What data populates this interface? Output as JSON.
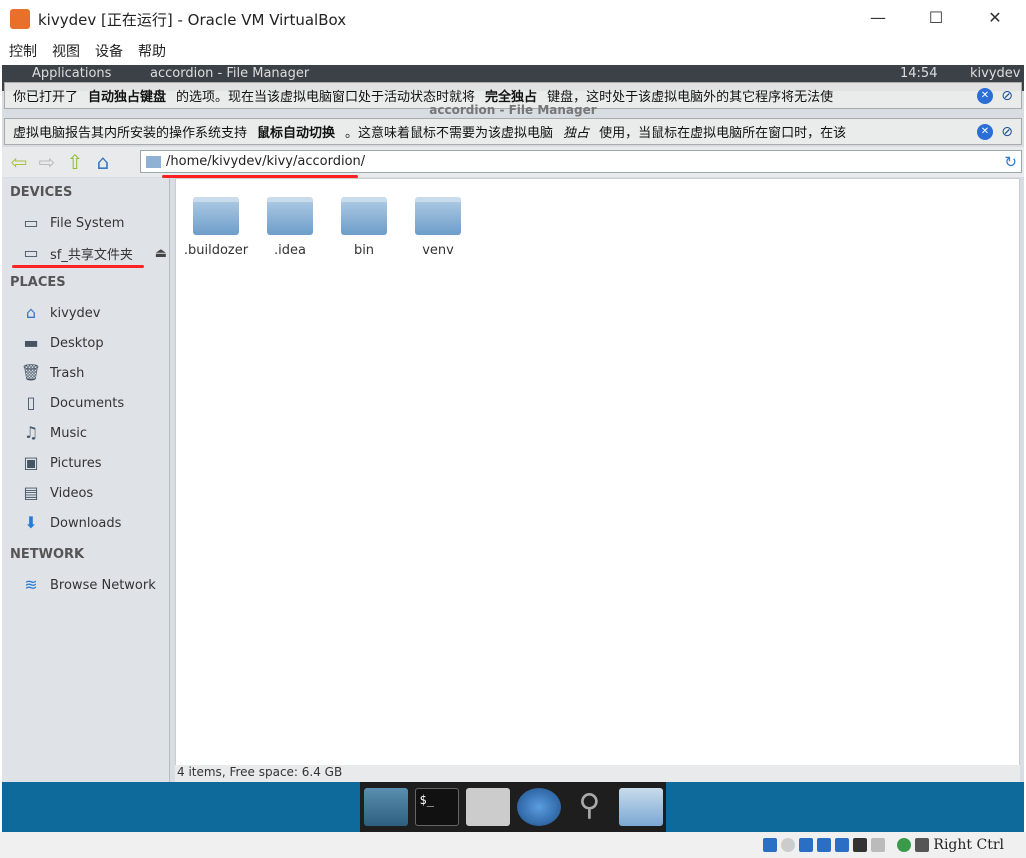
{
  "window": {
    "title": "kivydev [正在运行] - Oracle VM VirtualBox",
    "minimize": "—",
    "maximize": "☐",
    "close": "✕"
  },
  "menu": [
    "控制",
    "视图",
    "设备",
    "帮助"
  ],
  "panel": {
    "apps": "Applications",
    "task": "accordion - File Manager",
    "time": "14:54",
    "user": "kivydev"
  },
  "notifications": [
    {
      "pre": "你已打开了",
      "bold1": "自动独占键盘",
      "mid": "的选项。现在当该虚拟电脑窗口处于活动状态时就将",
      "bold2": "完全独占",
      "post": "键盘，这时处于该虚拟电脑外的其它程序将无法使"
    },
    {
      "pre": "虚拟电脑报告其内所安装的操作系统支持",
      "bold1": "鼠标自动切换",
      "mid": "。这意味着鼠标不需要为该虚拟电脑",
      "bold2": "独占",
      "post": "使用，当鼠标在虚拟电脑所在窗口时，在该"
    }
  ],
  "fm": {
    "title": "accordion - File Manager",
    "path": "/home/kivydev/kivy/accordion/"
  },
  "sidebar": {
    "devices_label": "DEVICES",
    "devices": [
      {
        "label": "File System",
        "icon": "harddisk-icon"
      },
      {
        "label": "sf_共享文件夹",
        "icon": "drive-icon"
      }
    ],
    "places_label": "PLACES",
    "places": [
      {
        "label": "kivydev",
        "icon": "home-icon"
      },
      {
        "label": "Desktop",
        "icon": "desktop-icon"
      },
      {
        "label": "Trash",
        "icon": "trash-icon"
      },
      {
        "label": "Documents",
        "icon": "documents-icon"
      },
      {
        "label": "Music",
        "icon": "music-icon"
      },
      {
        "label": "Pictures",
        "icon": "pictures-icon"
      },
      {
        "label": "Videos",
        "icon": "videos-icon"
      },
      {
        "label": "Downloads",
        "icon": "downloads-icon"
      }
    ],
    "network_label": "NETWORK",
    "network": [
      {
        "label": "Browse Network",
        "icon": "wifi-icon"
      }
    ]
  },
  "files": [
    ".buildozer",
    ".idea",
    "bin",
    "venv"
  ],
  "status": "4 items, Free space: 6.4 GB",
  "host_status": {
    "key": "Right Ctrl"
  }
}
